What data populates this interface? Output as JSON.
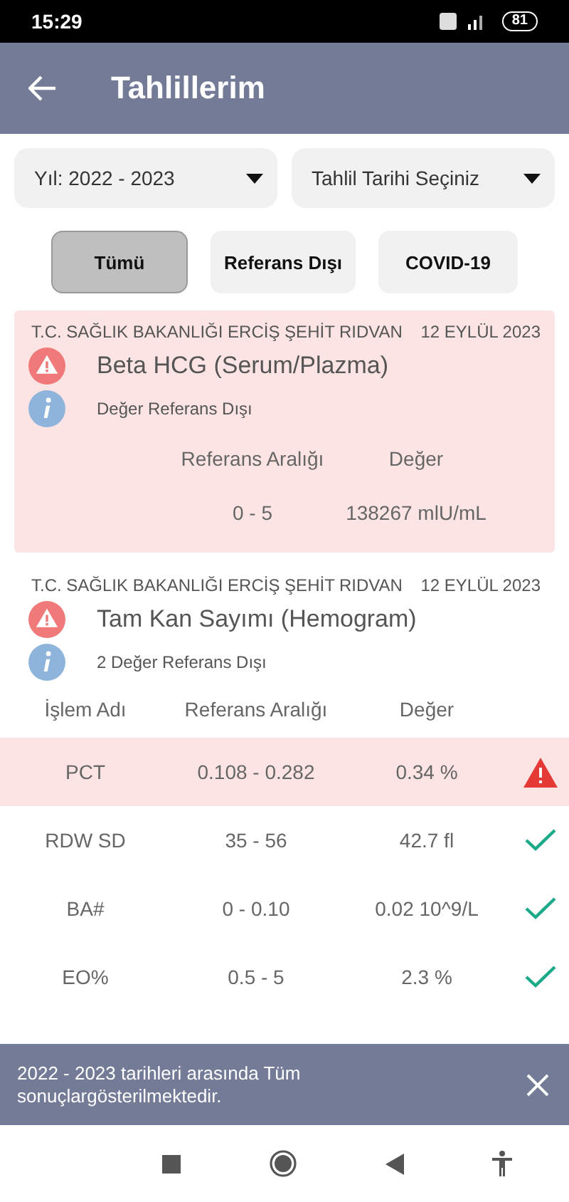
{
  "status_bar": {
    "time": "15:29",
    "battery": "81"
  },
  "header": {
    "title": "Tahlillerim"
  },
  "dropdowns": [
    {
      "label": "Yıl: 2022 - 2023"
    },
    {
      "label": "Tahlil Tarihi Seçiniz"
    }
  ],
  "filters": [
    {
      "label": "Tümü",
      "selected": true
    },
    {
      "label": "Referans Dışı",
      "selected": false
    },
    {
      "label": "COVID-19",
      "selected": false
    }
  ],
  "results": [
    {
      "hospital": "T.C. SAĞLIK BAKANLIĞI ERCİŞ ŞEHİT RIDVAN",
      "date": "12 EYLÜL 2023",
      "test": "Beta HCG (Serum/Plazma)",
      "note": "Değer Referans Dışı",
      "highlighted": true,
      "columns": [
        "Referans Aralığı",
        "Değer"
      ],
      "rows": [
        {
          "cells": [
            "0 - 5",
            "138267 mlU/mL"
          ]
        }
      ]
    },
    {
      "hospital": "T.C. SAĞLIK BAKANLIĞI ERCİŞ ŞEHİT RIDVAN",
      "date": "12 EYLÜL 2023",
      "test": "Tam Kan Sayımı (Hemogram)",
      "note": "2 Değer Referans Dışı",
      "highlighted": false,
      "columns": [
        "İşlem Adı",
        "Referans Aralığı",
        "Değer"
      ],
      "rows": [
        {
          "cells": [
            "PCT",
            "0.108 - 0.282",
            "0.34 %"
          ],
          "out_of_range": true
        },
        {
          "cells": [
            "RDW SD",
            "35 - 56",
            "42.7 fl"
          ],
          "out_of_range": false
        },
        {
          "cells": [
            "BA#",
            "0 - 0.10",
            "0.02 10^9/L"
          ],
          "out_of_range": false
        },
        {
          "cells": [
            "EO%",
            "0.5 - 5",
            "2.3 %"
          ],
          "out_of_range": false
        }
      ]
    }
  ],
  "snackbar": {
    "message": "2022 - 2023 tarihleri arasında Tüm sonuçlargösterilmektedir."
  }
}
